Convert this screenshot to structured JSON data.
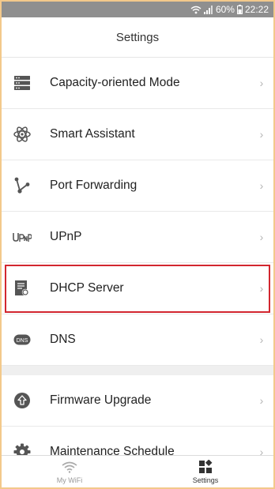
{
  "statusbar": {
    "battery": "60%",
    "time": "22:22"
  },
  "header": {
    "title": "Settings"
  },
  "items_group1": [
    {
      "label": "Capacity-oriented Mode",
      "icon": "server-icon"
    },
    {
      "label": "Smart Assistant",
      "icon": "atom-icon"
    },
    {
      "label": "Port Forwarding",
      "icon": "fork-icon"
    },
    {
      "label": "UPnP",
      "icon": "upnp-icon"
    },
    {
      "label": "DHCP Server",
      "icon": "dhcp-document-icon"
    },
    {
      "label": "DNS",
      "icon": "dns-icon"
    }
  ],
  "items_group2": [
    {
      "label": "Firmware Upgrade",
      "icon": "upload-circle-icon"
    },
    {
      "label": "Maintenance Schedule",
      "icon": "gear-icon"
    }
  ],
  "tabbar": {
    "tabs": [
      {
        "label": "My WiFi",
        "icon": "wifi-icon"
      },
      {
        "label": "Settings",
        "icon": "grid-icon"
      }
    ]
  },
  "colors": {
    "highlight": "#d2262f",
    "icon": "#555555",
    "statusbar": "#8f8f8f"
  }
}
